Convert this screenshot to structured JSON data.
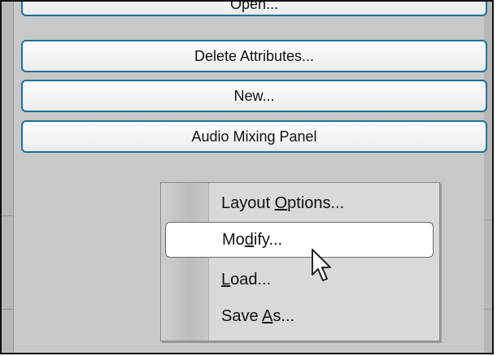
{
  "panel": {
    "buttons": [
      {
        "label": "Open..."
      },
      {
        "label": "Delete Attributes..."
      },
      {
        "label": "New..."
      },
      {
        "label": "Audio Mixing Panel"
      }
    ]
  },
  "context_menu": {
    "items": [
      {
        "before": "Layout ",
        "mnemonic": "O",
        "after": "ptions...",
        "highlighted": false
      },
      {
        "before": "Mo",
        "mnemonic": "d",
        "after": "ify...",
        "highlighted": true
      },
      {
        "before": "",
        "mnemonic": "L",
        "after": "oad...",
        "highlighted": false
      },
      {
        "before": "Save ",
        "mnemonic": "A",
        "after": "s...",
        "highlighted": false
      }
    ]
  },
  "cursor": {
    "icon": "mouse-pointer-icon"
  }
}
